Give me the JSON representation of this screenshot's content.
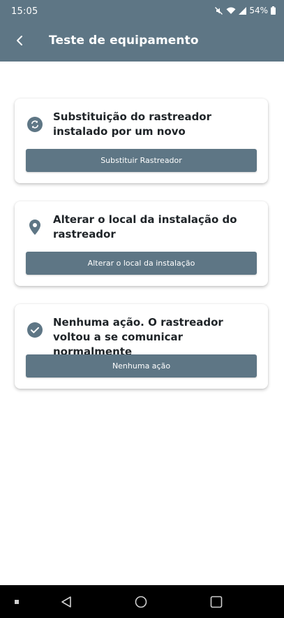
{
  "status_bar": {
    "time": "15:05",
    "battery": "54%",
    "icons": [
      "mute-icon",
      "wifi-icon",
      "signal-icon",
      "battery-icon"
    ]
  },
  "app_bar": {
    "back_icon": "chevron-left-icon",
    "title": "Teste de equipamento"
  },
  "options": [
    {
      "icon": "sync-icon",
      "title": "Substituição do rastreador instalado por um novo",
      "button_label": "Substituir Rastreador"
    },
    {
      "icon": "location-pin-icon",
      "title": "Alterar o local da instalação do rastreador",
      "button_label": "Alterar o local da instalação"
    },
    {
      "icon": "check-circle-icon",
      "title": "Nenhuma ação. O rastreador voltou a se comunicar normalmente",
      "button_label": "Nenhuma ação"
    }
  ],
  "nav_bar": {
    "items": [
      "recents-dot-icon",
      "back-triangle-icon",
      "home-circle-icon",
      "overview-square-icon"
    ]
  },
  "colors": {
    "primary": "#5e7685",
    "title_text": "#1f2428",
    "background": "#ffffff"
  }
}
